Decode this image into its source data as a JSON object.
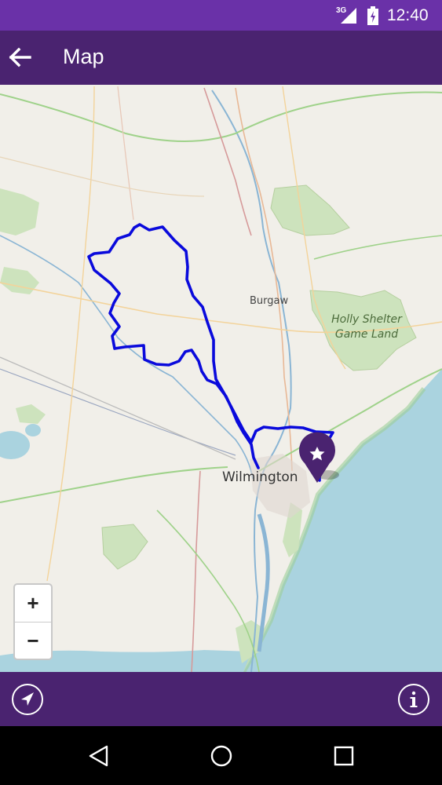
{
  "status_bar": {
    "network": "3G",
    "time": "12:40"
  },
  "app_bar": {
    "title": "Map"
  },
  "map": {
    "labels": {
      "burgaw": "Burgaw",
      "holly_shelter": "Holly Shelter Game Land",
      "wilmington": "Wilmington"
    },
    "zoom_in": "+",
    "zoom_out": "−",
    "route_color": "#0a0adc",
    "marker_color": "#4a2370"
  },
  "bottom_bar": {
    "locate_icon": "navigation-arrow-icon",
    "info_icon": "info-icon"
  },
  "nav_bar": {
    "back": "back-icon",
    "home": "home-icon",
    "recents": "recents-icon"
  }
}
